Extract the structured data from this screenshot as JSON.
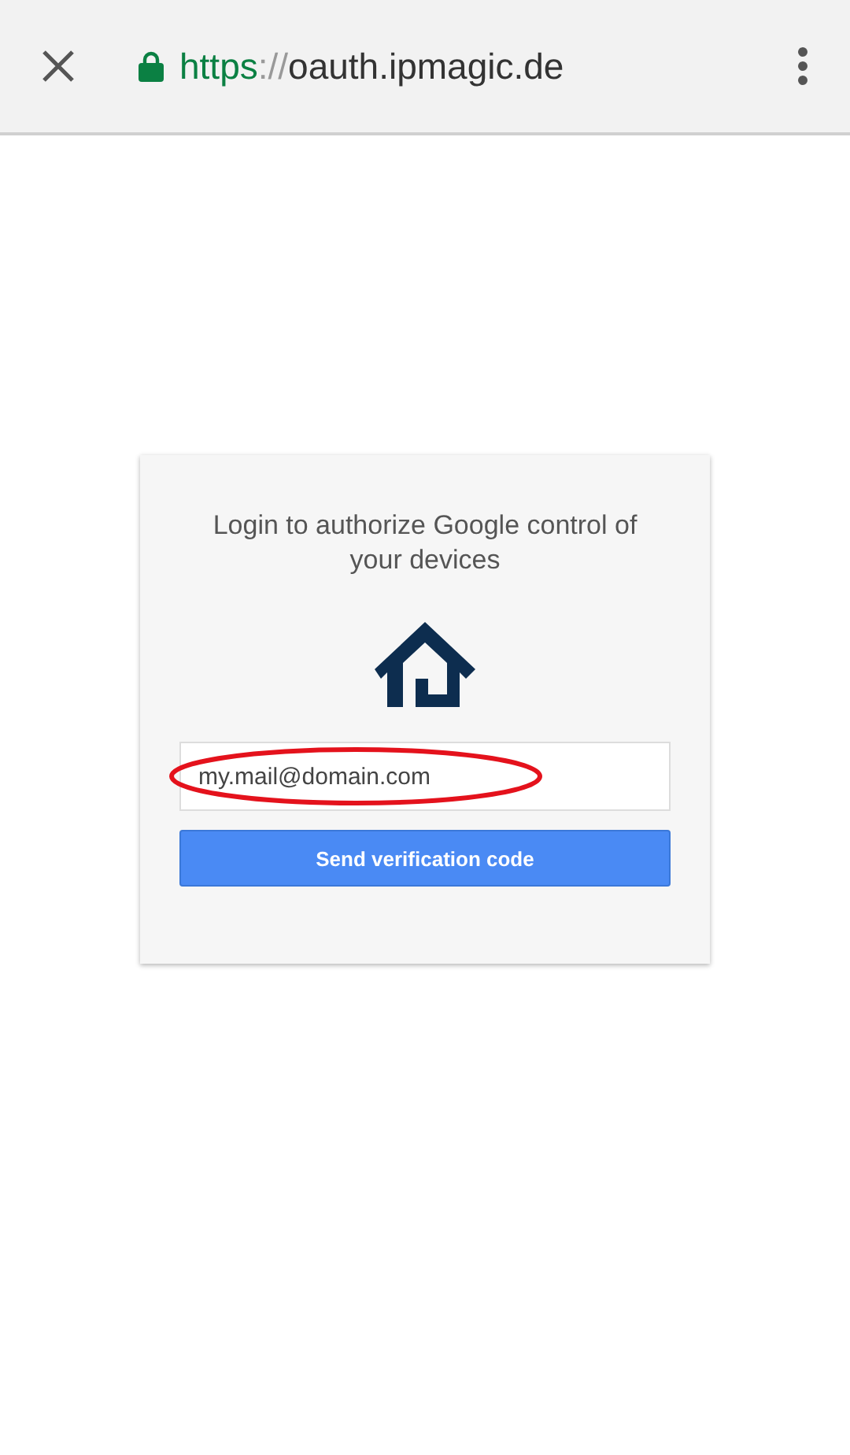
{
  "toolbar": {
    "secure": true,
    "url": {
      "scheme": "https",
      "separator": "://",
      "host": "oauth.ipmagic.de"
    }
  },
  "card": {
    "heading": "Login to authorize Google control of your devices",
    "email": {
      "value": "my.mail@domain.com",
      "circled": true
    },
    "button": "Send verification code"
  }
}
